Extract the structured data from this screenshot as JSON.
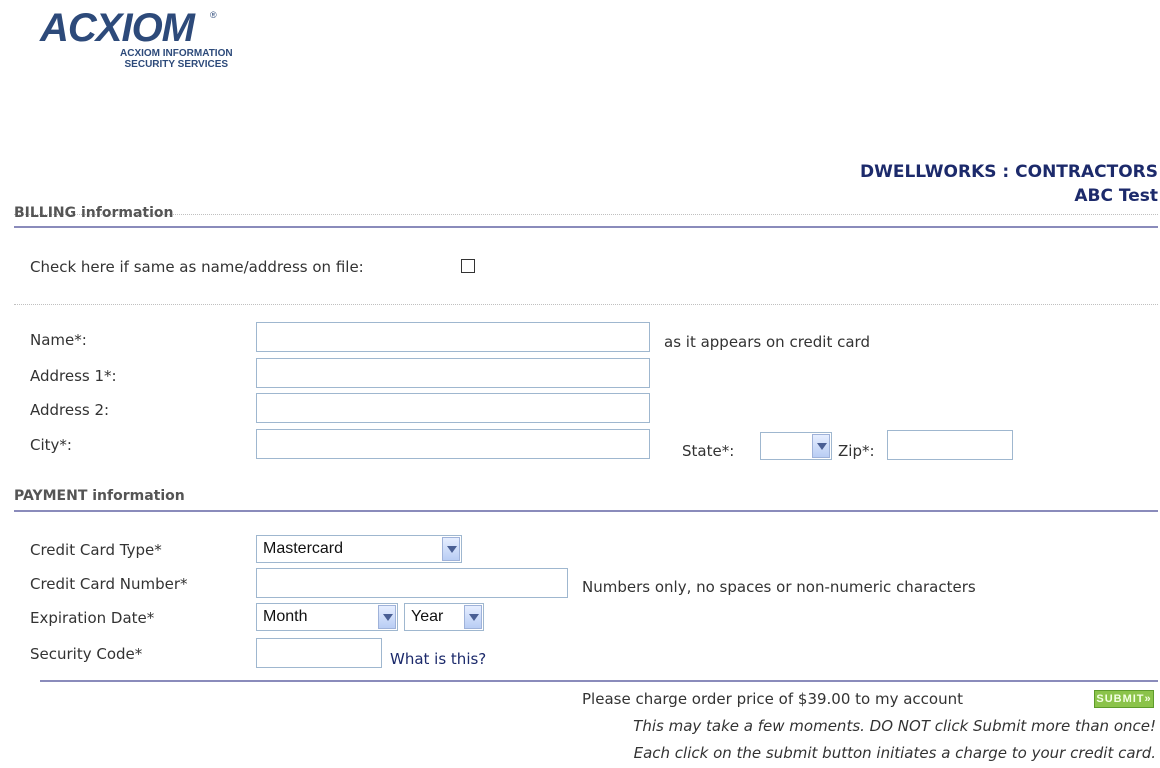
{
  "logo": {
    "word": "ACXIOM",
    "registered": "®",
    "subtitle_line1": "ACXIOM INFORMATION",
    "subtitle_line2": "SECURITY SERVICES"
  },
  "header": {
    "company": "DWELLWORKS : CONTRACTORS",
    "name": "ABC Test"
  },
  "billing": {
    "section_title": "BILLING information",
    "same_as_label": "Check here if same as name/address on file:",
    "same_as_checked": false,
    "name_label": "Name*:",
    "name_value": "",
    "name_hint": "as it appears on credit card",
    "address1_label": "Address 1*:",
    "address1_value": "",
    "address2_label": "Address 2:",
    "address2_value": "",
    "city_label": "City*:",
    "city_value": "",
    "state_label": "State*:",
    "state_value": "",
    "zip_label": "Zip*:",
    "zip_value": ""
  },
  "payment": {
    "section_title": "PAYMENT information",
    "card_type_label": "Credit Card Type*",
    "card_type_value": "Mastercard",
    "card_number_label": "Credit Card Number*",
    "card_number_value": "",
    "card_number_hint": "Numbers only, no spaces or non-numeric characters",
    "expiration_label": "Expiration Date*",
    "month_value": "Month",
    "year_value": "Year",
    "security_code_label": "Security Code*",
    "security_code_value": "",
    "what_is_this": "What is this?"
  },
  "footer": {
    "charge_text": "Please charge order price of $39.00 to my account",
    "submit_label": "SUBMIT»",
    "warning1": "This may take a few moments. DO NOT click Submit more than once!",
    "warning2": "Each click on the submit button initiates a charge to your credit card."
  },
  "colors": {
    "header_text": "#1c2a6b",
    "rule": "#8a8bbb",
    "input_border": "#9fb7cf",
    "submit_bg": "#8bc34a"
  }
}
